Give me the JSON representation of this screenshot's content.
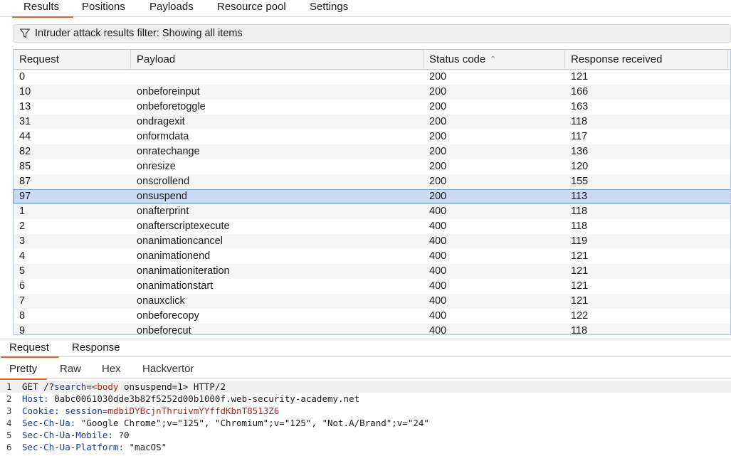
{
  "top_tabs": [
    "Results",
    "Positions",
    "Payloads",
    "Resource pool",
    "Settings"
  ],
  "filter": {
    "icon": "funnel-icon",
    "text": "Intruder attack results filter: Showing all items"
  },
  "table": {
    "columns": [
      "Request",
      "Payload",
      "Status code",
      "Response received"
    ],
    "sort_indicator": "^",
    "rows": [
      {
        "request": "0",
        "payload": "",
        "status": "200",
        "response": "121"
      },
      {
        "request": "10",
        "payload": "onbeforeinput",
        "status": "200",
        "response": "166"
      },
      {
        "request": "13",
        "payload": "onbeforetoggle",
        "status": "200",
        "response": "163"
      },
      {
        "request": "31",
        "payload": "ondragexit",
        "status": "200",
        "response": "118"
      },
      {
        "request": "44",
        "payload": "onformdata",
        "status": "200",
        "response": "117"
      },
      {
        "request": "82",
        "payload": "onratechange",
        "status": "200",
        "response": "136"
      },
      {
        "request": "85",
        "payload": "onresize",
        "status": "200",
        "response": "120"
      },
      {
        "request": "87",
        "payload": "onscrollend",
        "status": "200",
        "response": "155"
      },
      {
        "request": "97",
        "payload": "onsuspend",
        "status": "200",
        "response": "113"
      },
      {
        "request": "1",
        "payload": "onafterprint",
        "status": "400",
        "response": "118"
      },
      {
        "request": "2",
        "payload": "onafterscriptexecute",
        "status": "400",
        "response": "118"
      },
      {
        "request": "3",
        "payload": "onanimationcancel",
        "status": "400",
        "response": "119"
      },
      {
        "request": "4",
        "payload": "onanimationend",
        "status": "400",
        "response": "121"
      },
      {
        "request": "5",
        "payload": "onanimationiteration",
        "status": "400",
        "response": "121"
      },
      {
        "request": "6",
        "payload": "onanimationstart",
        "status": "400",
        "response": "121"
      },
      {
        "request": "7",
        "payload": "onauxclick",
        "status": "400",
        "response": "121"
      },
      {
        "request": "8",
        "payload": "onbeforecopy",
        "status": "400",
        "response": "122"
      },
      {
        "request": "9",
        "payload": "onbeforecut",
        "status": "400",
        "response": "118"
      }
    ],
    "selected_request": "97"
  },
  "lower_tabs": [
    "Request",
    "Response"
  ],
  "view_tabs": [
    "Pretty",
    "Raw",
    "Hex",
    "Hackvertor"
  ],
  "editor": {
    "lines": [
      {
        "n": "1",
        "parts": [
          [
            "plain",
            "GET /?"
          ],
          [
            "pname",
            "search"
          ],
          [
            "plain",
            "="
          ],
          [
            "pval",
            "<body"
          ],
          [
            "plain",
            " onsuspend=1> HTTP/2"
          ]
        ]
      },
      {
        "n": "2",
        "parts": [
          [
            "hname",
            "Host:"
          ],
          [
            "plain",
            " 0abc0061030dde3b82f5252d00b1000f.web-security-academy.net"
          ]
        ]
      },
      {
        "n": "3",
        "parts": [
          [
            "hname",
            "Cookie:"
          ],
          [
            "plain",
            " "
          ],
          [
            "pname",
            "session"
          ],
          [
            "plain",
            "="
          ],
          [
            "cookie-val",
            "mdbiDYBcjnThruivmYYffdKbnT8513Z6"
          ]
        ]
      },
      {
        "n": "4",
        "parts": [
          [
            "hname",
            "Sec-Ch-Ua:"
          ],
          [
            "plain",
            " \"Google Chrome\";v=\"125\", \"Chromium\";v=\"125\", \"Not.A/Brand\";v=\"24\""
          ]
        ]
      },
      {
        "n": "5",
        "parts": [
          [
            "hname",
            "Sec-Ch-Ua-Mobile:"
          ],
          [
            "plain",
            " ?0"
          ]
        ]
      },
      {
        "n": "6",
        "parts": [
          [
            "hname",
            "Sec-Ch-Ua-Platform:"
          ],
          [
            "plain",
            " \"macOS\""
          ]
        ]
      }
    ]
  }
}
